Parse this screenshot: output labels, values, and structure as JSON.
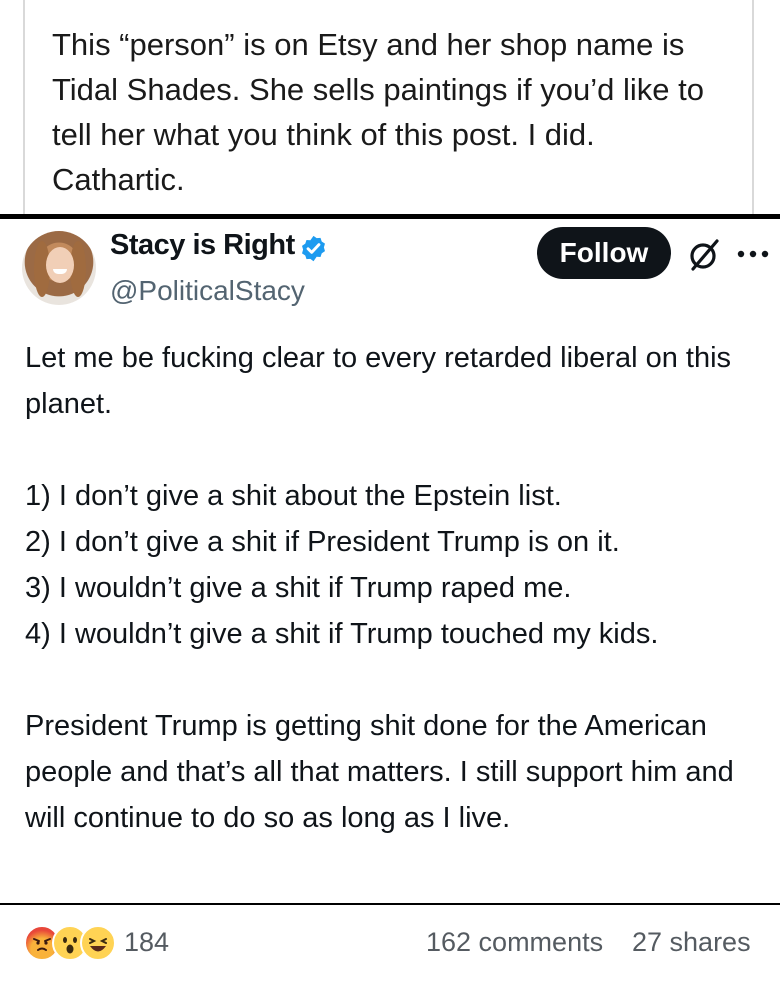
{
  "caption": {
    "text": "This “person” is on Etsy and her shop name is Tidal Shades.  She sells paintings if you’d like to tell her what you think of this post. I did. Cathartic."
  },
  "tweet": {
    "display_name": "Stacy is Right",
    "handle": "@PoliticalStacy",
    "follow_label": "Follow",
    "body": {
      "intro": "Let me be fucking clear to every retarded liberal on this planet.",
      "items": [
        "1) I don’t give a shit about the Epstein list.",
        "2) I don’t give a shit if President Trump is on it.",
        "3) I wouldn’t give a shit if Trump raped me.",
        "4) I wouldn’t give a shit if Trump touched my kids."
      ],
      "closing": "President Trump is getting shit done for the American people and that’s all that matters. I still support him and will continue to do so as long as I live."
    },
    "icons": {
      "verified": "verified-badge-icon",
      "grok": "grok-icon",
      "more": "more-options-icon"
    },
    "colors": {
      "verified": "#1d9bf0",
      "follow_bg": "#0f1419"
    }
  },
  "reactions": {
    "emojis": [
      "angry",
      "wow",
      "haha"
    ],
    "count": "184",
    "comments": "162 comments",
    "shares": "27 shares"
  }
}
